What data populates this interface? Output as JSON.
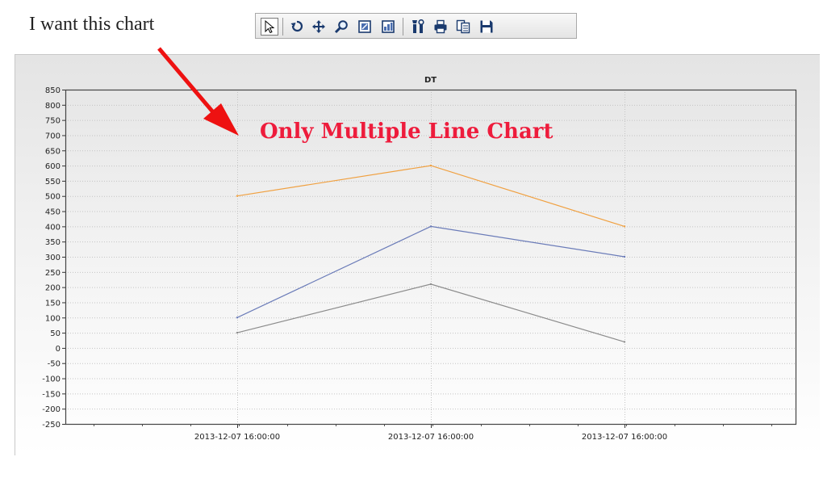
{
  "note": {
    "text": "I want this chart"
  },
  "toolbar": {
    "buttons": [
      {
        "name": "select-tool",
        "icon": "cursor-arrow-icon"
      },
      {
        "name": "reset",
        "icon": "rotate-icon"
      },
      {
        "name": "pan",
        "icon": "pan-arrows-icon"
      },
      {
        "name": "zoom",
        "icon": "zoom-magnifier-icon"
      },
      {
        "name": "zoom-in-box",
        "icon": "zoom-in-box-icon"
      },
      {
        "name": "zoom-out-box",
        "icon": "zoom-out-box-icon"
      },
      {
        "name": "settings",
        "icon": "tools-icon"
      },
      {
        "name": "print",
        "icon": "printer-icon"
      },
      {
        "name": "copy",
        "icon": "copy-icon"
      },
      {
        "name": "save",
        "icon": "floppy-disk-icon"
      }
    ]
  },
  "annotation": {
    "text": "Only Multiple Line Chart",
    "color": "#ee1c3c"
  },
  "chart_data": {
    "type": "line",
    "title": "DT",
    "xlabel": "",
    "ylabel": "",
    "categories": [
      "2013-12-07 16:00:00",
      "2013-12-07 16:00:00",
      "2013-12-07 16:00:00"
    ],
    "series": [
      {
        "color": "#f0a040",
        "values": [
          500,
          600,
          400
        ]
      },
      {
        "color": "#6a7bb8",
        "values": [
          100,
          400,
          300
        ]
      },
      {
        "color": "#8c8c8c",
        "values": [
          50,
          210,
          20
        ]
      }
    ],
    "ylim": [
      -250,
      850
    ],
    "yticks": [
      850,
      800,
      750,
      700,
      650,
      600,
      550,
      500,
      450,
      400,
      350,
      300,
      250,
      200,
      150,
      100,
      50,
      0,
      -50,
      -100,
      -150,
      -200,
      -250
    ],
    "grid": true,
    "legend": "none"
  }
}
